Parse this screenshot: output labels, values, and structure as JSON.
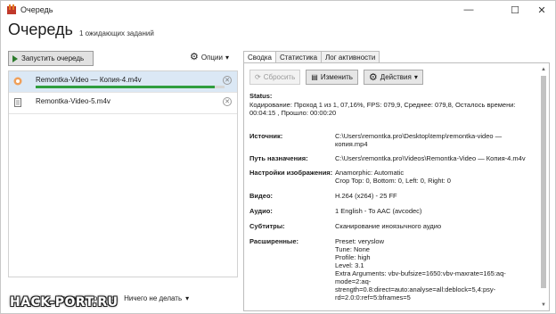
{
  "window": {
    "title": "Очередь",
    "minimize": "—",
    "maximize": "☐",
    "close": "✕"
  },
  "header": {
    "title": "Очередь",
    "waiting": "1 ожидающих заданий"
  },
  "left": {
    "start_label": "Запустить очередь",
    "options_label": "Опции",
    "items": [
      {
        "name": "Remontka-Video — Копия-4.m4v",
        "progress": 0.95
      },
      {
        "name": "Remontka-Video-5.m4v"
      }
    ],
    "when_done_label": "Когда завершено:",
    "when_done_value": "Ничего не делать"
  },
  "right": {
    "tabs": [
      "Сводка",
      "Статистика",
      "Лог активности"
    ],
    "toolbar": {
      "reset": "Сбросить",
      "edit": "Изменить",
      "actions": "Действия"
    },
    "status_label": "Status:",
    "status_text": "Кодирование: Проход 1 из 1, 07,16%, FPS: 079,9, Среднее: 079,8, Осталось времени:\n00:04:15 , Прошло: 00:00:20",
    "rows": [
      {
        "label": "Источник:",
        "value": "C:\\Users\\remontka.pro\\Desktop\\temp\\remontka-video —\nкопия.mp4"
      },
      {
        "label": "Путь назначения:",
        "value": "C:\\Users\\remontka.pro\\Videos\\Remontka-Video — Копия-4.m4v"
      },
      {
        "label": "Настройки изображения:",
        "value": "Anamorphic: Automatic\nCrop Top: 0, Bottom: 0, Left: 0, Right: 0"
      },
      {
        "label": "Видео:",
        "value": "H.264 (x264) - 25 FF"
      },
      {
        "label": "Аудио:",
        "value": "1 English -  To AAC (avcodec)"
      },
      {
        "label": "Субтитры:",
        "value": "Сканирование иноязычного аудио"
      },
      {
        "label": "Расширенные:",
        "value": "Preset: veryslow\nTune: None\nProfile: high\nLevel: 3.1\nExtra Arguments: vbv-bufsize=1650:vbv-maxrate=165:aq-\nmode=2:aq-\nstrength=0.8:direct=auto:analyse=all:deblock=5,4:psy-\nrd=2.0:0:ref=5:bframes=5"
      }
    ]
  },
  "watermark": "HACK-PORT.RU",
  "colors": {
    "progress": "#2f9e3f",
    "selected_row": "#dbe8f5"
  }
}
